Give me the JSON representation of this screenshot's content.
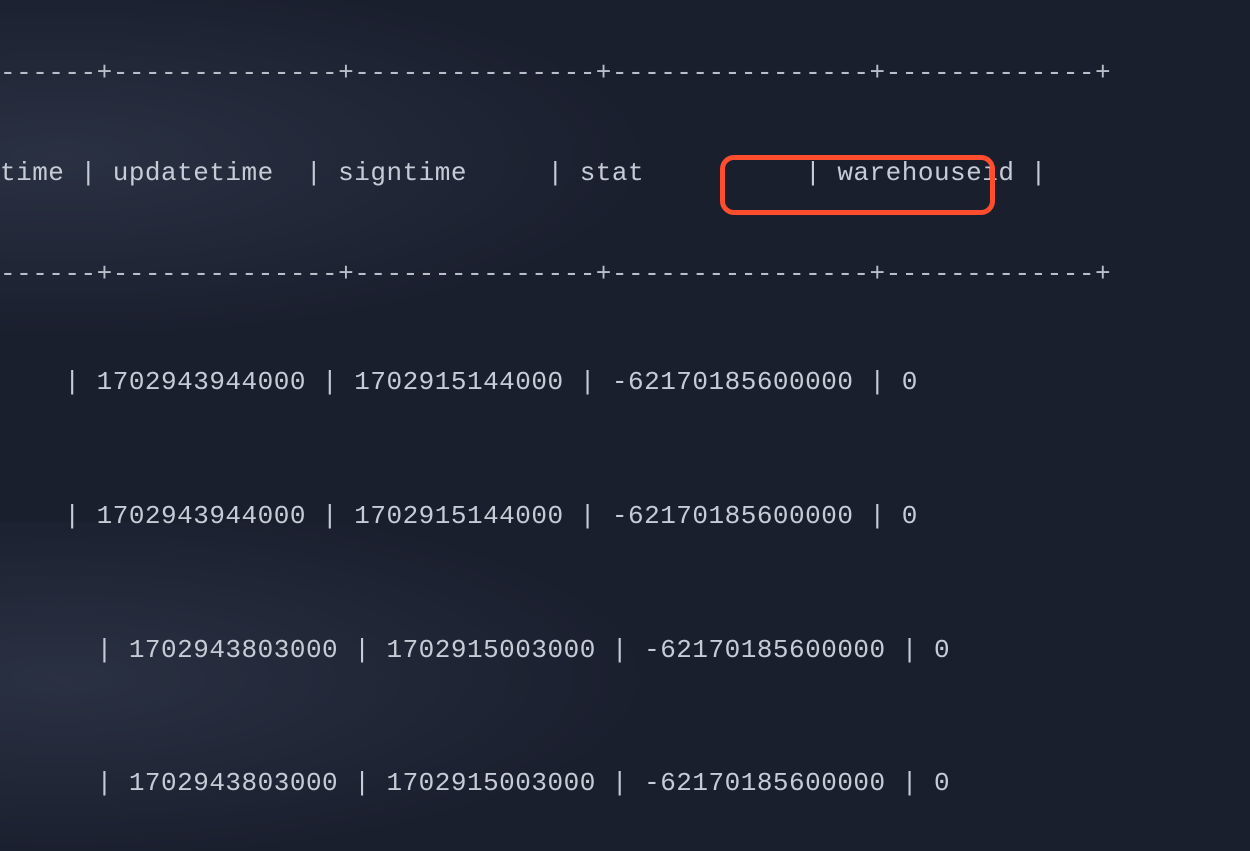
{
  "table": {
    "divider_top": "------+--------------+---------------+----------------+-------------+",
    "header": "time | updatetime  | signtime     | stat          | warehouseid |",
    "divider_mid": "------+--------------+---------------+----------------+-------------+",
    "rows": [
      "    | 1702943944000 | 1702915144000 | -62170185600000 | 0",
      "    | 1702943944000 | 1702915144000 | -62170185600000 | 0",
      "      | 1702943803000 | 1702915003000 | -62170185600000 | 0",
      "      | 1702943803000 | 1702915003000 | -62170185600000 | 0"
    ]
  },
  "highlighted_value": "-62170185600000"
}
